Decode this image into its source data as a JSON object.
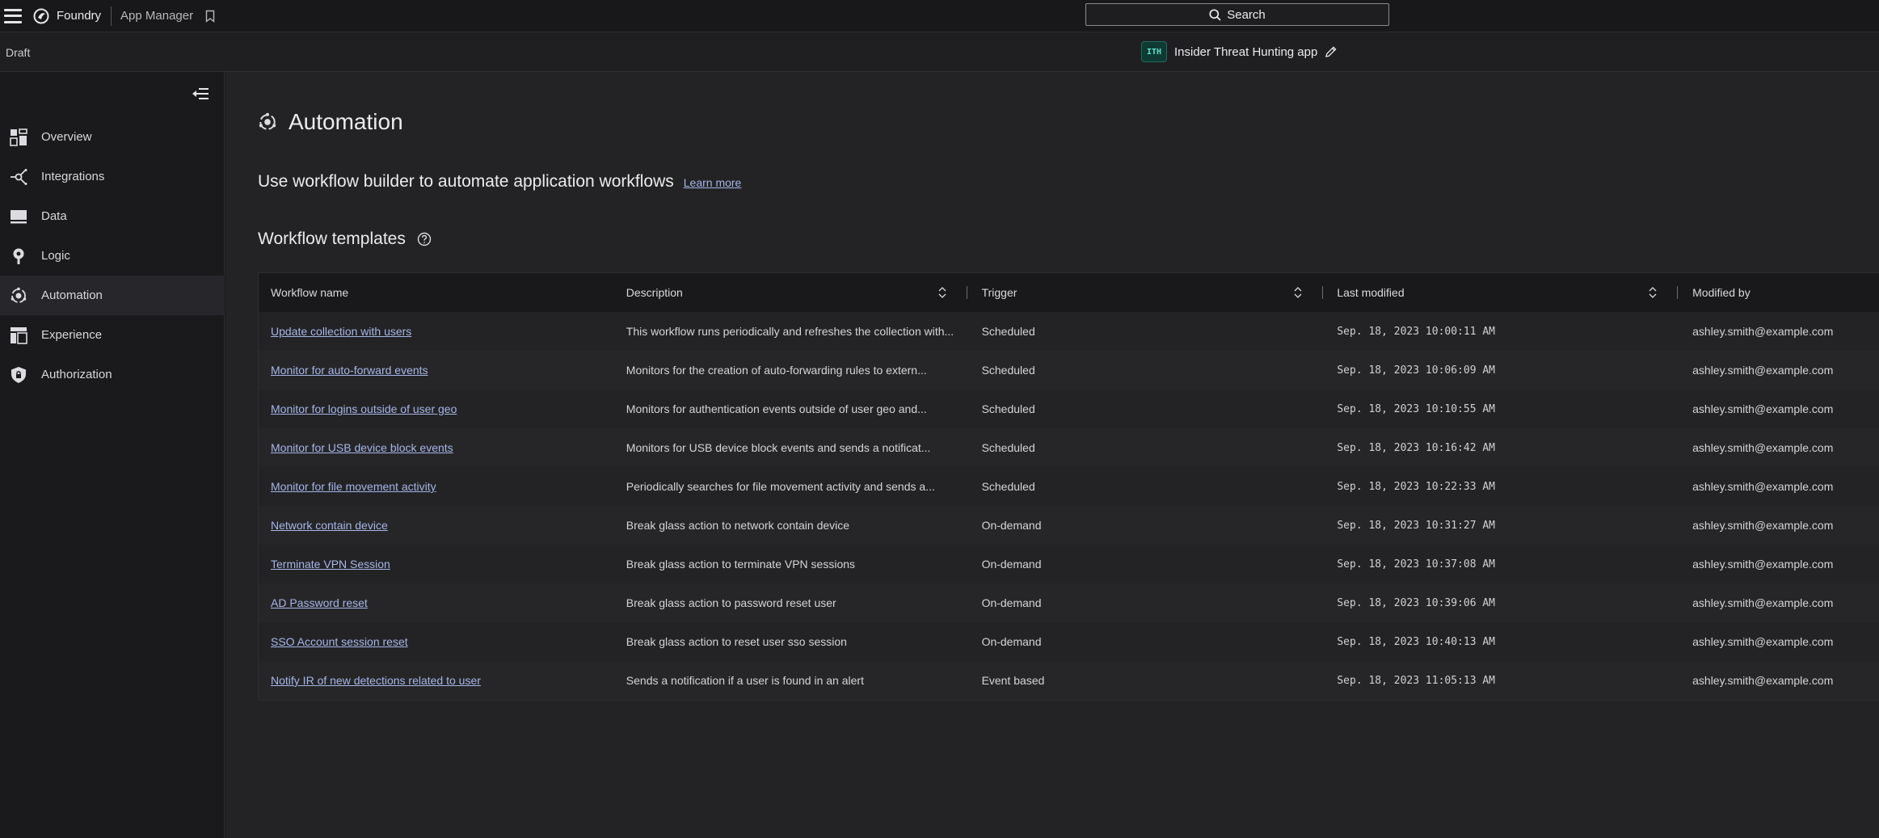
{
  "topbar": {
    "brand": "Foundry",
    "section": "App Manager",
    "search_label": "Search"
  },
  "subbar": {
    "status": "Draft",
    "app_badge": "ITH",
    "app_title": "Insider Threat Hunting app"
  },
  "sidebar": {
    "items": [
      {
        "label": "Overview",
        "icon": "grid-icon"
      },
      {
        "label": "Integrations",
        "icon": "integrations-icon"
      },
      {
        "label": "Data",
        "icon": "monitor-icon"
      },
      {
        "label": "Logic",
        "icon": "lightbulb-icon"
      },
      {
        "label": "Automation",
        "icon": "automation-icon"
      },
      {
        "label": "Experience",
        "icon": "layout-icon"
      },
      {
        "label": "Authorization",
        "icon": "shield-lock-icon"
      }
    ],
    "active": "Automation"
  },
  "main": {
    "title": "Automation",
    "tagline": "Use workflow builder to automate application workflows",
    "learn_more": "Learn more",
    "section_title": "Workflow templates",
    "table": {
      "headers": [
        "Workflow name",
        "Description",
        "Trigger",
        "Last modified",
        "Modified by"
      ],
      "rows": [
        {
          "name": "Update collection with users",
          "description": "This workflow runs periodically and refreshes the collection with...",
          "trigger": "Scheduled",
          "modified": "Sep. 18, 2023 10:00:11 AM",
          "by": "ashley.smith@example.com"
        },
        {
          "name": "Monitor for auto-forward events",
          "description": "Monitors for the creation of auto-forwarding rules to extern...",
          "trigger": "Scheduled",
          "modified": "Sep. 18, 2023 10:06:09 AM",
          "by": "ashley.smith@example.com"
        },
        {
          "name": "Monitor for logins outside of user geo",
          "description": "Monitors for authentication events outside of user geo and...",
          "trigger": "Scheduled",
          "modified": "Sep. 18, 2023 10:10:55 AM",
          "by": "ashley.smith@example.com"
        },
        {
          "name": "Monitor for USB device block events",
          "description": "Monitors for USB device block events and sends a notificat...",
          "trigger": "Scheduled",
          "modified": "Sep. 18, 2023 10:16:42 AM",
          "by": "ashley.smith@example.com"
        },
        {
          "name": "Monitor for file movement activity",
          "description": "Periodically searches for file movement activity and sends a...",
          "trigger": "Scheduled",
          "modified": "Sep. 18, 2023 10:22:33 AM",
          "by": "ashley.smith@example.com"
        },
        {
          "name": "Network contain device",
          "description": "Break glass action to network contain device",
          "trigger": "On-demand",
          "modified": "Sep. 18, 2023 10:31:27 AM",
          "by": "ashley.smith@example.com"
        },
        {
          "name": "Terminate VPN Session",
          "description": "Break glass action to terminate VPN sessions",
          "trigger": "On-demand",
          "modified": "Sep. 18, 2023 10:37:08 AM",
          "by": "ashley.smith@example.com"
        },
        {
          "name": "AD Password reset",
          "description": "Break glass action to password reset user",
          "trigger": "On-demand",
          "modified": "Sep. 18, 2023 10:39:06 AM",
          "by": "ashley.smith@example.com"
        },
        {
          "name": "SSO Account session reset",
          "description": "Break glass action to reset user sso session",
          "trigger": "On-demand",
          "modified": "Sep. 18, 2023 10:40:13 AM",
          "by": "ashley.smith@example.com"
        },
        {
          "name": "Notify IR of new detections related to user",
          "description": "Sends a notification if a user is found in an alert",
          "trigger": "Event based",
          "modified": "Sep. 18, 2023 11:05:13 AM",
          "by": "ashley.smith@example.com"
        }
      ]
    }
  },
  "colors": {
    "background": "#1b1b1e",
    "link": "#a6b6e6",
    "text": "#e6e6e8"
  }
}
